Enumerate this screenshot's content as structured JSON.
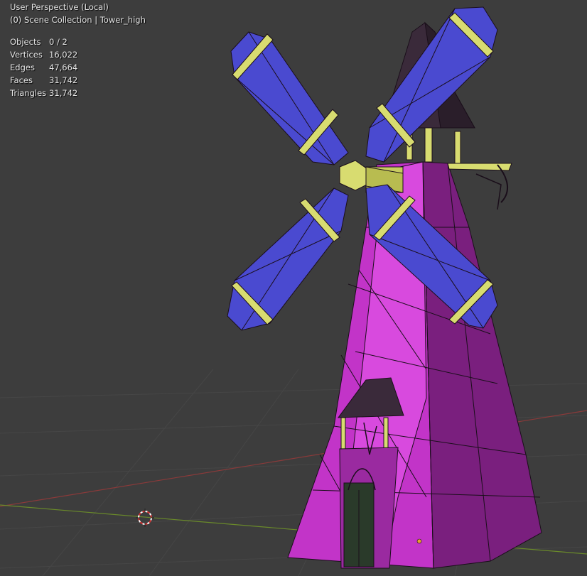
{
  "viewport": {
    "view_name": "User Perspective (Local)",
    "collection_info": "(0) Scene Collection | Tower_high"
  },
  "stats": [
    {
      "label": "Objects",
      "value": "0 / 2"
    },
    {
      "label": "Vertices",
      "value": "16,022"
    },
    {
      "label": "Edges",
      "value": "47,664"
    },
    {
      "label": "Faces",
      "value": "31,742"
    },
    {
      "label": "Triangles",
      "value": "31,742"
    }
  ],
  "colors": {
    "background": "#3d3d3d",
    "grid_line": "#474747",
    "x_axis": "#8a3a3a",
    "y_axis": "#6a8a2a",
    "tower": "#c234c8",
    "tower_dark": "#7a1f7e",
    "tower_light": "#e060e6",
    "sail": "#4a4ad0",
    "sail_dark": "#2c2c9a",
    "frame": "#d8dc70",
    "roof": "#3a2a3a",
    "wire": "#1a0e1a"
  }
}
